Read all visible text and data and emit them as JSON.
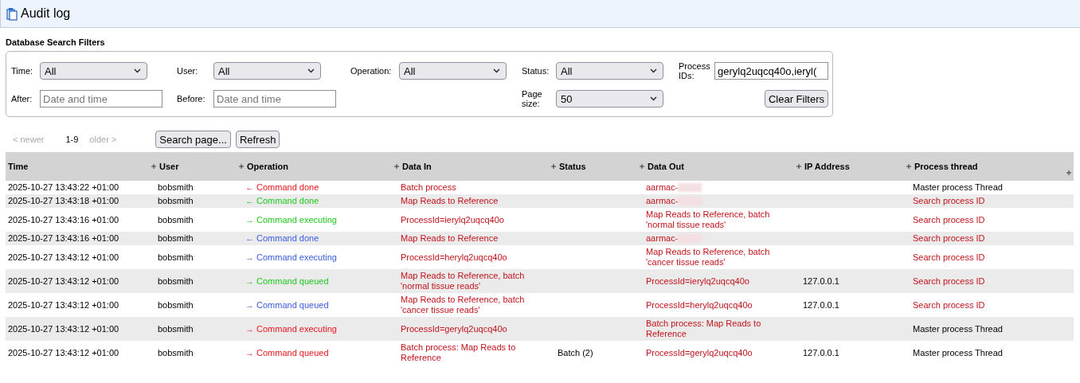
{
  "window": {
    "title": "Audit log"
  },
  "filters": {
    "title": "Database Search Filters",
    "rows": [
      [
        {
          "kind": "select",
          "label": "Time:",
          "value": "All"
        },
        {
          "kind": "select",
          "label": "User:",
          "value": "All"
        },
        {
          "kind": "select",
          "label": "Operation:",
          "value": "All"
        },
        {
          "kind": "select",
          "label": "Status:",
          "value": "All"
        },
        {
          "kind": "input",
          "label": "Process IDs:",
          "value": "gerylq2uqcq40o,ieryl("
        }
      ],
      [
        {
          "kind": "input",
          "label": "After:",
          "placeholder": "Date and time"
        },
        {
          "kind": "input",
          "label": "Before:",
          "placeholder": "Date and time"
        },
        {
          "kind": "empty"
        },
        {
          "kind": "select",
          "label": "Page size:",
          "value": "50"
        },
        {
          "kind": "button",
          "label": "Clear Filters"
        }
      ]
    ]
  },
  "pager": {
    "newer": {
      "label": "< newer",
      "disabled": true
    },
    "range": "1-9",
    "older": {
      "label": "older >",
      "disabled": true
    },
    "buttons": [
      "Search page...",
      "Refresh"
    ]
  },
  "table": {
    "columns": [
      "Time",
      "User",
      "Operation",
      "Data In",
      "Status",
      "Data Out",
      "IP Address",
      "Process thread"
    ],
    "rows": [
      {
        "time": "2025-10-27 13:43:22 +01:00",
        "user": "bobsmith",
        "operation": "← Command done",
        "color": "#e8141b",
        "data_in": "Batch process",
        "status": "",
        "data_out": "aarmac-",
        "redacted": true,
        "ip": "",
        "thread": "Master process Thread",
        "thread_link": false
      },
      {
        "time": "2025-10-27 13:43:18 +01:00",
        "user": "bobsmith",
        "operation": "← Command done",
        "color": "#1ec81e",
        "data_in": "Map Reads to Reference",
        "status": "",
        "data_out": "aarmac-",
        "redacted": true,
        "ip": "",
        "thread": "Search process ID",
        "thread_link": true
      },
      {
        "time": "2025-10-27 13:43:16 +01:00",
        "user": "bobsmith",
        "operation": "→ Command executing",
        "color": "#1ec81e",
        "data_in": "ProcessId=ierylq2uqcq40o",
        "status": "",
        "data_out": "Map Reads to Reference, batch 'normal tissue reads'",
        "redacted": false,
        "ip": "",
        "thread": "Search process ID",
        "thread_link": true
      },
      {
        "time": "2025-10-27 13:43:16 +01:00",
        "user": "bobsmith",
        "operation": "← Command done",
        "color": "#3a5ce0",
        "data_in": "Map Reads to Reference",
        "status": "",
        "data_out": "aarmac-",
        "redacted": true,
        "ip": "",
        "thread": "Search process ID",
        "thread_link": true
      },
      {
        "time": "2025-10-27 13:43:12 +01:00",
        "user": "bobsmith",
        "operation": "→ Command executing",
        "color": "#3a5ce0",
        "data_in": "ProcessId=herylq2uqcq40o",
        "status": "",
        "data_out": "Map Reads to Reference, batch 'cancer tissue reads'",
        "redacted": false,
        "ip": "",
        "thread": "Search process ID",
        "thread_link": true
      },
      {
        "time": "2025-10-27 13:43:12 +01:00",
        "user": "bobsmith",
        "operation": "→ Command queued",
        "color": "#1ec81e",
        "data_in": "Map Reads to Reference, batch 'normal tissue reads'",
        "status": "",
        "data_out": "ProcessId=ierylq2uqcq40o",
        "redacted": false,
        "ip": "127.0.0.1",
        "thread": "Search process ID",
        "thread_link": true
      },
      {
        "time": "2025-10-27 13:43:12 +01:00",
        "user": "bobsmith",
        "operation": "→ Command queued",
        "color": "#3a5ce0",
        "data_in": "Map Reads to Reference, batch 'cancer tissue reads'",
        "status": "",
        "data_out": "ProcessId=herylq2uqcq40o",
        "redacted": false,
        "ip": "127.0.0.1",
        "thread": "Search process ID",
        "thread_link": true
      },
      {
        "time": "2025-10-27 13:43:12 +01:00",
        "user": "bobsmith",
        "operation": "→ Command executing",
        "color": "#e8141b",
        "data_in": "ProcessId=gerylq2uqcq40o",
        "status": "",
        "data_out": "Batch process: Map Reads to Reference",
        "redacted": false,
        "ip": "",
        "thread": "Master process Thread",
        "thread_link": false
      },
      {
        "time": "2025-10-27 13:43:12 +01:00",
        "user": "bobsmith",
        "operation": "→ Command queued",
        "color": "#e8141b",
        "data_in": "Batch process: Map Reads to Reference",
        "status": "Batch (2)",
        "data_out": "ProcessId=gerylq2uqcq40o",
        "redacted": false,
        "ip": "127.0.0.1",
        "thread": "Master process Thread",
        "thread_link": false
      }
    ]
  }
}
